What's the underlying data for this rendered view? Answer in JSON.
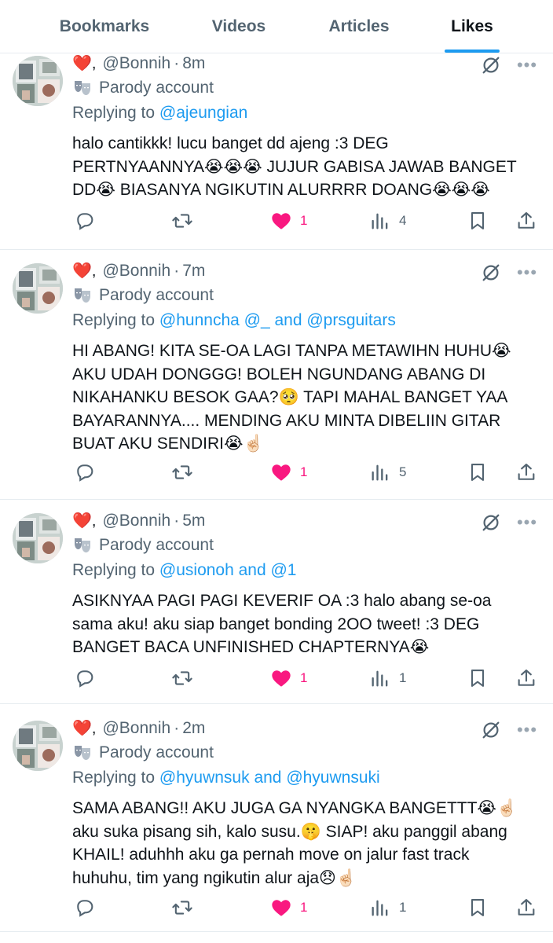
{
  "tabs": [
    {
      "label": "Bookmarks",
      "active": false
    },
    {
      "label": "Videos",
      "active": false
    },
    {
      "label": "Articles",
      "active": false
    },
    {
      "label": "Likes",
      "active": true
    }
  ],
  "colors": {
    "accent": "#1d9bf0",
    "like": "#f91880",
    "muted": "#536471",
    "text": "#0f1419"
  },
  "tweets": [
    {
      "display_name": "❤️,",
      "handle": "@Bonnih",
      "time": "8m",
      "parody_label": "Parody account",
      "replying_prefix": "Replying to",
      "replying_mentions": "@ajeungian",
      "text_lines": [
        "halo cantikkk! lucu banget dd ajeng :3 DEG",
        "PERTNYAANNYA😭😭😭 JUJUR GABISA JAWAB BANGET",
        "DD😭 BIASANYA NGIKUTIN ALURRRR DOANG😭😭😭"
      ],
      "likes": "1",
      "views": "4"
    },
    {
      "display_name": "❤️,",
      "handle": "@Bonnih",
      "time": "7m",
      "parody_label": "Parody account",
      "replying_prefix": "Replying to",
      "replying_mentions": "@hunncha @_ and @prsguitars",
      "text_lines": [
        "HI ABANG! KITA SE-OA LAGI TANPA METAWIHN HUHU😭",
        "AKU UDAH DONGGG! BOLEH NGUNDANG ABANG DI",
        "NIKAHANKU BESOK GAA?🥺 TAPI MAHAL BANGET YAA",
        "BAYARANNYA.... MENDING AKU MINTA DIBELIIN GITAR",
        "BUAT AKU SENDIRI😭☝🏻"
      ],
      "likes": "1",
      "views": "5"
    },
    {
      "display_name": "❤️,",
      "handle": "@Bonnih",
      "time": "5m",
      "parody_label": "Parody account",
      "replying_prefix": "Replying to",
      "replying_mentions": "@usionoh and @1",
      "text_lines": [
        "ASIKNYAA PAGI PAGI KEVERIF OA :3 halo abang se-oa",
        "sama aku! aku siap banget bonding 2OO tweet! :3 DEG",
        "BANGET BACA UNFINISHED CHAPTERNYA😭"
      ],
      "likes": "1",
      "views": "1"
    },
    {
      "display_name": "❤️,",
      "handle": "@Bonnih",
      "time": "2m",
      "parody_label": "Parody account",
      "replying_prefix": "Replying to",
      "replying_mentions": "@hyuwnsuk and @hyuwnsuki",
      "text_lines": [
        "SAMA ABANG!! AKU JUGA GA NYANGKA BANGETTT😭☝🏻",
        "aku suka pisang sih, kalo susu.🤫 SIAP! aku panggil abang",
        "KHAIL! aduhhh aku ga pernah move on jalur fast track",
        "huhuhu, tim yang ngikutin alur aja😞☝🏻"
      ],
      "likes": "1",
      "views": "1"
    }
  ]
}
